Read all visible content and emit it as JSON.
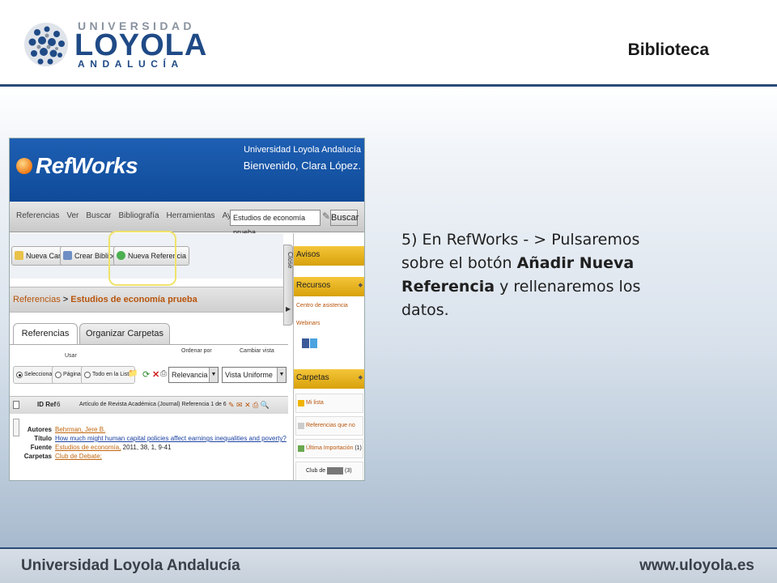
{
  "header": {
    "logo": {
      "top": "UNIVERSIDAD",
      "main": "LOYOLA",
      "bottom": "ANDALUCÍA"
    },
    "section_title": "Biblioteca"
  },
  "footer": {
    "left": "Universidad Loyola Andalucía",
    "right": "www.uloyola.es"
  },
  "instruction": {
    "part1": "5) En RefWorks - > Pulsaremos sobre el botón ",
    "bold": "Añadir Nueva Referencia",
    "part2": " y rellenaremos los datos."
  },
  "refworks": {
    "logo_text": "RefWorks",
    "institution": "Universidad Loyola Andalucía",
    "welcome": "Bienvenido, Clara López.",
    "menu": [
      "Referencias",
      "Ver",
      "Buscar",
      "Bibliografía",
      "Herramientas",
      "Ayuda"
    ],
    "search_value": "Estudios de economía prueba",
    "search_button": "Buscar",
    "toolbar": {
      "new_folder": "Nueva Carpeta",
      "create_bibliography": "Crear Bibliografía",
      "new_reference": "Nueva Referencia"
    },
    "breadcrumb": {
      "root": "Referencias",
      "separator": ">",
      "current": "Estudios de economía prueba"
    },
    "tabs": {
      "references": "Referencias",
      "organize": "Organizar Carpetas"
    },
    "controls": {
      "use_label": "Usar",
      "sort_label": "Ordenar por",
      "view_label": "Cambiar vista",
      "radio_selected": "Seleccionado",
      "radio_page": "Página",
      "radio_all": "Todo en la Lista",
      "sort_value": "Relevancia",
      "view_value": "Vista Uniforme"
    },
    "reference": {
      "id_label": "ID Ref",
      "id_value": "6",
      "type_text": "Artículo de Revista Académica (Journal) Referencia 1 de 6",
      "authors_label": "Autores",
      "authors": "Behrman, Jere B.",
      "title_label": "Título",
      "title": "How much might human capital policies affect earnings inequalities and poverty?",
      "source_label": "Fuente",
      "source_link": "Estudios de economía,",
      "source_rest": " 2011, 38, 1, 9-41",
      "folders_label": "Carpetas",
      "folders": "Club de Debate;"
    },
    "close_label": "Close",
    "sidebar": {
      "avisos": "Avisos",
      "recursos": "Recursos",
      "help_center": "Centro de asistencia",
      "webinars": "Webinars",
      "carpetas": "Carpetas",
      "my_list": "Mi lista",
      "not_in": "Referencias que no están e",
      "last_import": "Última Importación",
      "last_import_count": "(1)",
      "club": "Club de",
      "club_count": "(3)"
    },
    "colors": {
      "brand_blue": "#1e5fb3",
      "highlight": "#f0e36a",
      "link_orange": "#b8540a"
    }
  }
}
